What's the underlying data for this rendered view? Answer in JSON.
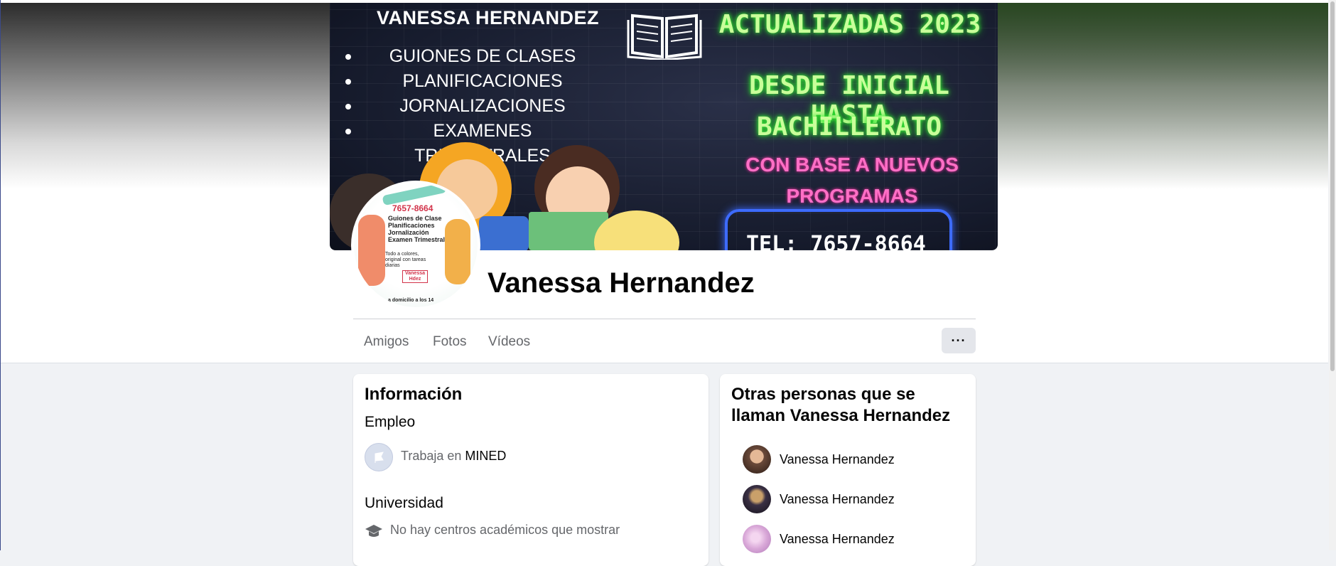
{
  "cover": {
    "title": "VANESSA HERNANDEZ",
    "services": [
      "GUIONES DE CLASES",
      "PLANIFICACIONES",
      "JORNALIZACIONES",
      "EXAMENES TRIMESTRALES"
    ],
    "headline": "ACTUALIZADAS 2023",
    "line1": "DESDE INICIAL HASTA",
    "line2": "BACHILLERATO",
    "pink1": "CON BASE A NUEVOS",
    "pink2": "PROGRAMAS",
    "tel": "TEL: 7657-8664"
  },
  "avatar": {
    "phone": "7657-8664",
    "lines": [
      "Guiones de Clase",
      "Planificaciones",
      "Jornalización",
      "Examen Trimestral"
    ],
    "small": "Todo a colores, original con tareas diarias",
    "tag": "Vanessa Hdez",
    "bottom": "a domicilio a los 14"
  },
  "profile": {
    "name": "Vanessa Hernandez"
  },
  "nav": {
    "tabs": [
      "Amigos",
      "Fotos",
      "Vídeos"
    ],
    "more_label": "···"
  },
  "info": {
    "title": "Información",
    "work_label": "Empleo",
    "work_prefix": "Trabaja en ",
    "work_place": "MINED",
    "edu_label": "Universidad",
    "edu_text": "No hay centros académicos que mostrar"
  },
  "others": {
    "title_line1": "Otras personas que se",
    "title_line2": "llaman Vanessa Hernandez",
    "people": [
      {
        "name": "Vanessa Hernandez",
        "color": "#6b4a3a"
      },
      {
        "name": "Vanessa Hernandez",
        "color": "#3a3044"
      },
      {
        "name": "Vanessa Hernandez",
        "color": "#d9a8d8"
      }
    ]
  },
  "colors": {
    "background": "#f0f2f5",
    "muted_text": "#65676b",
    "button_bg": "#e4e6eb"
  }
}
